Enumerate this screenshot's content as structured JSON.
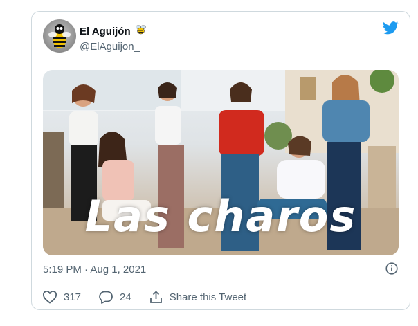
{
  "tweet": {
    "display_name": "El Aguijón",
    "handle": "@ElAguijon_",
    "name_badge_icon": "bee-icon",
    "logo_icon": "twitter-bird-icon",
    "timestamp": "5:19 PM · Aug 1, 2021",
    "media_overlay_text": "Las charos",
    "likes": "317",
    "replies": "24",
    "share_label": "Share this Tweet",
    "colors": {
      "brand_blue": "#1d9bf0",
      "text_primary": "#0f1419",
      "text_secondary": "#536471",
      "border": "#cfd9de"
    }
  }
}
